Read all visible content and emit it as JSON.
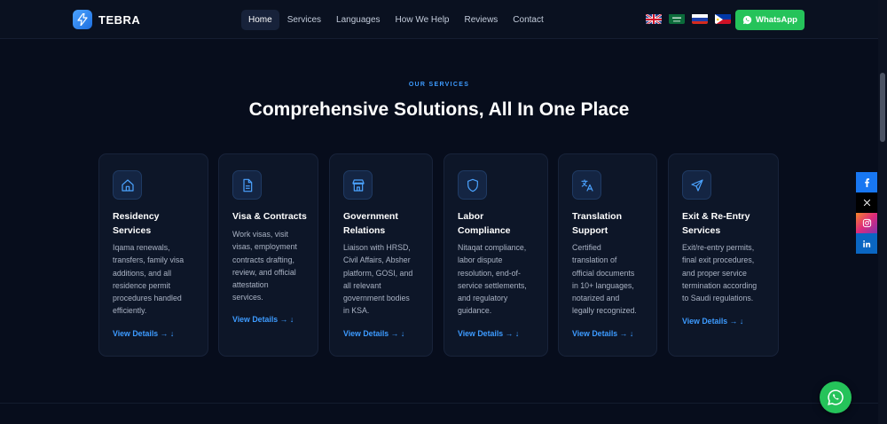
{
  "brand": {
    "name": "TEBRA",
    "icon": "lightning-icon"
  },
  "nav": {
    "items": [
      {
        "label": "Home",
        "active": true
      },
      {
        "label": "Services",
        "active": false
      },
      {
        "label": "Languages",
        "active": false
      },
      {
        "label": "How We Help",
        "active": false
      },
      {
        "label": "Reviews",
        "active": false
      },
      {
        "label": "Contact",
        "active": false
      }
    ],
    "flags": [
      "uk-flag-icon",
      "saudi-flag-icon",
      "russia-flag-icon",
      "philippines-flag-icon"
    ],
    "whatsapp_label": "WhatsApp"
  },
  "section": {
    "eyebrow": "OUR SERVICES",
    "headline": "Comprehensive Solutions, All In One Place"
  },
  "services": [
    {
      "title_lines": [
        "Residency",
        "Services"
      ],
      "icon": "home-icon",
      "desc_lines": [
        "Iqama renewals,",
        "transfers, family visa",
        "additions, and all",
        "residence permit",
        "procedures handled",
        "efficiently."
      ],
      "link": "View Details → ↓"
    },
    {
      "title_lines": [
        "Visa & Contracts"
      ],
      "icon": "document-icon",
      "desc_lines": [
        "Work visas, visit",
        "visas, employment",
        "contracts drafting,",
        "review, and official",
        "attestation",
        "services."
      ],
      "link": "View Details → ↓"
    },
    {
      "title_lines": [
        "Government",
        "Relations"
      ],
      "icon": "building-icon",
      "desc_lines": [
        "Liaison with HRSD,",
        "Civil Affairs, Absher",
        "platform, GOSI, and",
        "all relevant",
        "government bodies",
        "in KSA."
      ],
      "link": "View Details → ↓"
    },
    {
      "title_lines": [
        "Labor",
        "Compliance"
      ],
      "icon": "shield-icon",
      "desc_lines": [
        "Nitaqat compliance,",
        "labor dispute",
        "resolution, end-of-",
        "service settlements,",
        "and regulatory",
        "guidance."
      ],
      "link": "View Details → ↓"
    },
    {
      "title_lines": [
        "Translation",
        "Support"
      ],
      "icon": "translate-icon",
      "desc_lines": [
        "Certified",
        "translation of",
        "official documents",
        "in 10+ languages,",
        "notarized and",
        "legally recognized."
      ],
      "link": "View Details → ↓"
    },
    {
      "title_lines": [
        "Exit & Re-Entry",
        "Services"
      ],
      "icon": "send-icon",
      "desc_lines": [
        "Exit/re-entry permits,",
        "final exit procedures,",
        "and proper service",
        "termination according",
        "to Saudi regulations."
      ],
      "link": "View Details → ↓"
    }
  ],
  "social": [
    {
      "name": "facebook-icon",
      "glyph": "f",
      "color": "#1877f2"
    },
    {
      "name": "x-icon",
      "glyph": "𝕏",
      "color": "#000000"
    },
    {
      "name": "instagram-icon",
      "glyph": "",
      "color": "#e1306c"
    },
    {
      "name": "linkedin-icon",
      "glyph": "in",
      "color": "#0a66c2"
    }
  ],
  "colors": {
    "accent": "#3d9bff",
    "whatsapp": "#25c35a",
    "background": "#070d1c"
  }
}
